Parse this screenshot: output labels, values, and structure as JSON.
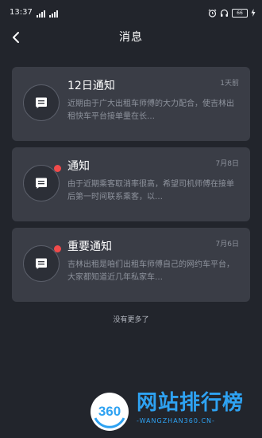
{
  "status_bar": {
    "time": "13:37",
    "battery": "66"
  },
  "header": {
    "title": "消息"
  },
  "messages": [
    {
      "title": "12日通知",
      "time": "1天前",
      "preview": "近期由于广大出租车师傅的大力配合，使吉林出租快车平台接单量在长…",
      "unread": false
    },
    {
      "title": "通知",
      "time": "7月8日",
      "preview": "由于近期乘客取消率很高，希望司机师傅在接单后第一时间联系乘客，以…",
      "unread": true
    },
    {
      "title": "重要通知",
      "time": "7月6日",
      "preview": "吉林出租是咱们出租车师傅自己的网约车平台，大家都知道近几年私家车…",
      "unread": true
    }
  ],
  "footer": {
    "no_more": "没有更多了"
  },
  "watermark": {
    "number": "360",
    "main": "网站排行榜",
    "sub": "-WANGZHAN360.CN-"
  },
  "colors": {
    "background": "#22252c",
    "card": "#3a3d46",
    "unread_dot": "#f04b4b",
    "watermark": "#2ea2f2"
  },
  "icons": {
    "back": "chevron-left-icon",
    "message": "message-bubble-icon",
    "alarm": "alarm-clock-icon",
    "headphones": "headphones-icon",
    "battery": "battery-icon",
    "charging": "lightning-icon"
  }
}
